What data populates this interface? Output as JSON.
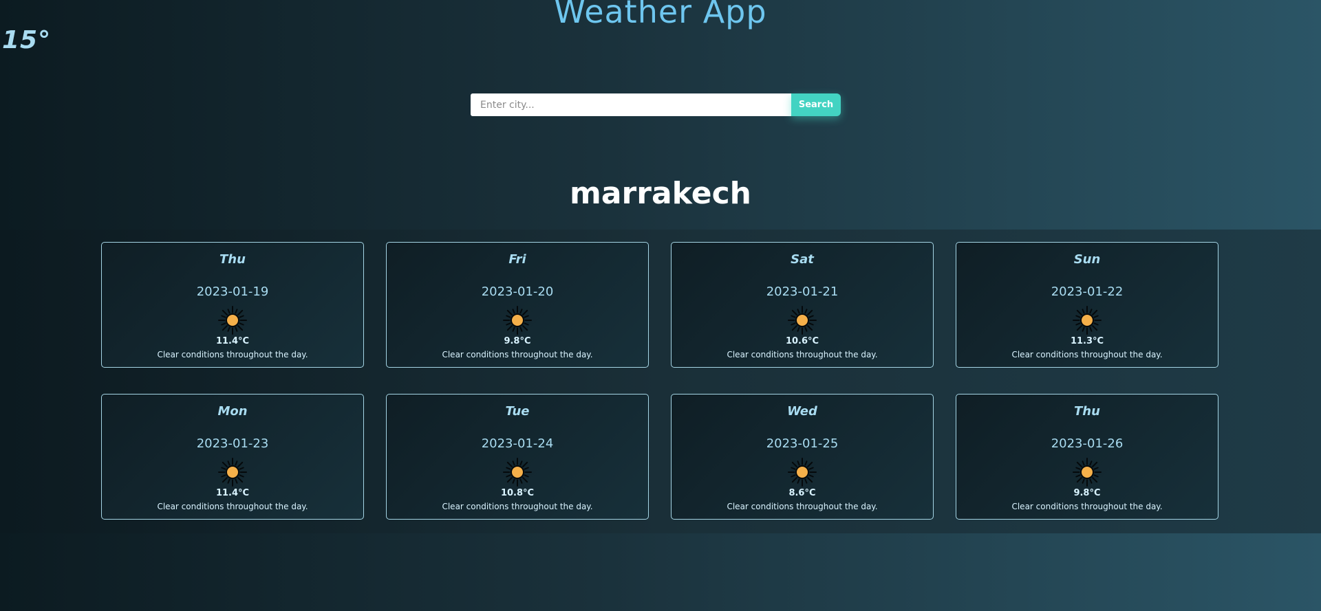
{
  "header": {
    "current_temp": "15°",
    "title": "Weather App"
  },
  "search": {
    "placeholder": "Enter city...",
    "value": "",
    "button_label": "Search"
  },
  "city": "marrakech",
  "forecast": [
    {
      "day": "Thu",
      "date": "2023-01-19",
      "icon": "sun-icon",
      "temp": "11.4°C",
      "desc": "Clear conditions throughout the day."
    },
    {
      "day": "Fri",
      "date": "2023-01-20",
      "icon": "sun-icon",
      "temp": "9.8°C",
      "desc": "Clear conditions throughout the day."
    },
    {
      "day": "Sat",
      "date": "2023-01-21",
      "icon": "sun-icon",
      "temp": "10.6°C",
      "desc": "Clear conditions throughout the day."
    },
    {
      "day": "Sun",
      "date": "2023-01-22",
      "icon": "sun-icon",
      "temp": "11.3°C",
      "desc": "Clear conditions throughout the day."
    },
    {
      "day": "Mon",
      "date": "2023-01-23",
      "icon": "sun-icon",
      "temp": "11.4°C",
      "desc": "Clear conditions throughout the day."
    },
    {
      "day": "Tue",
      "date": "2023-01-24",
      "icon": "sun-icon",
      "temp": "10.8°C",
      "desc": "Clear conditions throughout the day."
    },
    {
      "day": "Wed",
      "date": "2023-01-25",
      "icon": "sun-icon",
      "temp": "8.6°C",
      "desc": "Clear conditions throughout the day."
    },
    {
      "day": "Thu",
      "date": "2023-01-26",
      "icon": "sun-icon",
      "temp": "9.8°C",
      "desc": "Clear conditions throughout the day."
    }
  ],
  "colors": {
    "accent": "#43d3c2",
    "title": "#6ec6ef",
    "card_text": "#a9dcf1",
    "sun_fill": "#f5b04a"
  }
}
